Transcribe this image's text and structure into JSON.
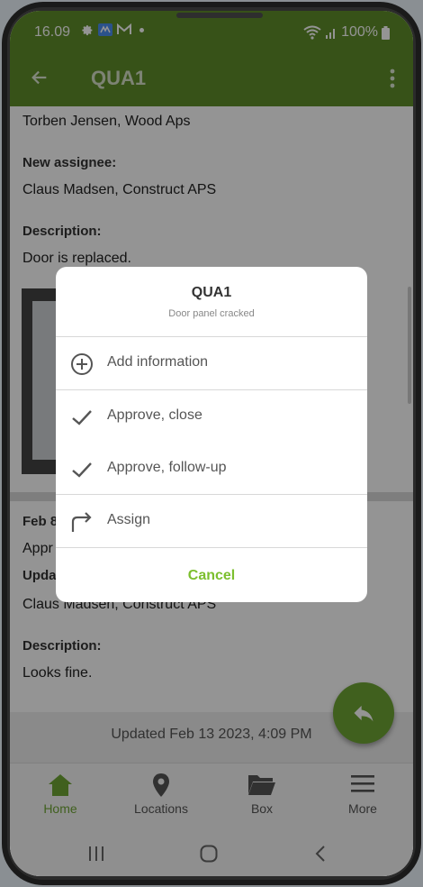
{
  "status_bar": {
    "time": "16.09",
    "battery": "100%"
  },
  "app_bar": {
    "title": "QUA1"
  },
  "content": {
    "from_value": "Torben Jensen, Wood Aps",
    "new_assignee_label": "New assignee:",
    "new_assignee_value": "Claus Madsen, Construct APS",
    "description_label": "Description:",
    "description_value": "Door is replaced.",
    "entry2_date": "Feb 8",
    "entry2_status": "Appr",
    "entry2_updated_label": "Upda",
    "entry2_assignee": "Claus Madsen, Construct APS",
    "description2_label": "Description:",
    "description2_value": "Looks fine.",
    "updated": "Updated Feb 13 2023, 4:09 PM"
  },
  "dialog": {
    "title": "QUA1",
    "subtitle": "Door panel cracked",
    "options": [
      {
        "label": "Add information",
        "icon": "plus-circle-icon"
      },
      {
        "label": "Approve, close",
        "icon": "check-icon"
      },
      {
        "label": "Approve, follow-up",
        "icon": "check-icon"
      },
      {
        "label": "Assign",
        "icon": "forward-arrow-icon"
      }
    ],
    "cancel": "Cancel"
  },
  "bottom_nav": [
    {
      "label": "Home",
      "icon": "home-icon",
      "active": true
    },
    {
      "label": "Locations",
      "icon": "location-pin-icon",
      "active": false
    },
    {
      "label": "Box",
      "icon": "folder-icon",
      "active": false
    },
    {
      "label": "More",
      "icon": "menu-icon",
      "active": false
    }
  ],
  "colors": {
    "primary": "#5f8e2a",
    "accent": "#7cbf2e",
    "fab": "#6ea534"
  }
}
